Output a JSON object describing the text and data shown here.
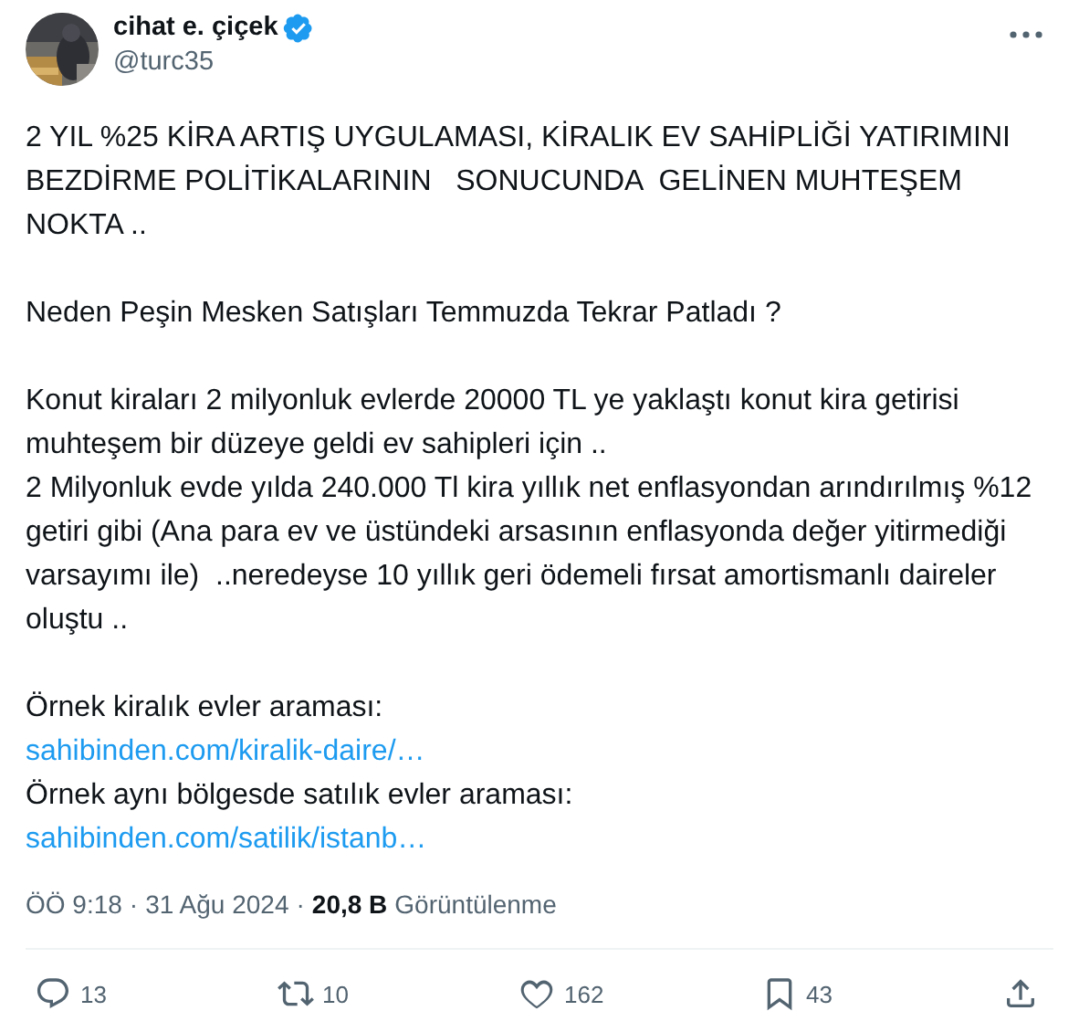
{
  "author": {
    "name": "cihat e. çiçek",
    "handle": "@turc35",
    "verified": true
  },
  "paragraphs": [
    {
      "lines": [
        {
          "kind": "text",
          "text": "2 YIL %25 KİRA ARTIŞ UYGULAMASI, KİRALIK EV SAHİPLİĞİ YATIRIMINI BEZDİRME POLİTİKALARININ   SONUCUNDA  GELİNEN MUHTEŞEM NOKTA .."
        }
      ]
    },
    {
      "lines": [
        {
          "kind": "text",
          "text": "Neden Peşin Mesken Satışları Temmuzda Tekrar Patladı ?"
        }
      ]
    },
    {
      "lines": [
        {
          "kind": "text",
          "text": "Konut kiraları 2 milyonluk evlerde 20000 TL ye yaklaştı konut kira getirisi muhteşem bir düzeye geldi ev sahipleri için .."
        },
        {
          "kind": "text",
          "text": "2 Milyonluk evde yılda 240.000 Tl kira yıllık net enflasyondan arındırılmış %12 getiri gibi (Ana para ev ve üstündeki arsasının enflasyonda değer yitirmediği varsayımı ile)  ..neredeyse 10 yıllık geri ödemeli fırsat amortismanlı daireler oluştu .."
        }
      ]
    },
    {
      "lines": [
        {
          "kind": "text",
          "text": "Örnek kiralık evler araması:"
        },
        {
          "kind": "link",
          "text": "sahibinden.com/kiralik-daire/…"
        },
        {
          "kind": "text",
          "text": "Örnek aynı bölgesde satılık evler araması:"
        },
        {
          "kind": "link",
          "text": "sahibinden.com/satilik/istanb…"
        }
      ]
    }
  ],
  "meta": {
    "separator_1": "·",
    "separator_2": "·",
    "time": "ÖÖ 9:18",
    "date": "31 Ağu 2024",
    "views": "20,8 B",
    "views_label": "Görüntülenme"
  },
  "actions": [
    {
      "kind": "reply",
      "count": "13"
    },
    {
      "kind": "repost",
      "count": "10"
    },
    {
      "kind": "like",
      "count": "162"
    },
    {
      "kind": "bookmark",
      "count": "43"
    },
    {
      "kind": "share"
    }
  ]
}
